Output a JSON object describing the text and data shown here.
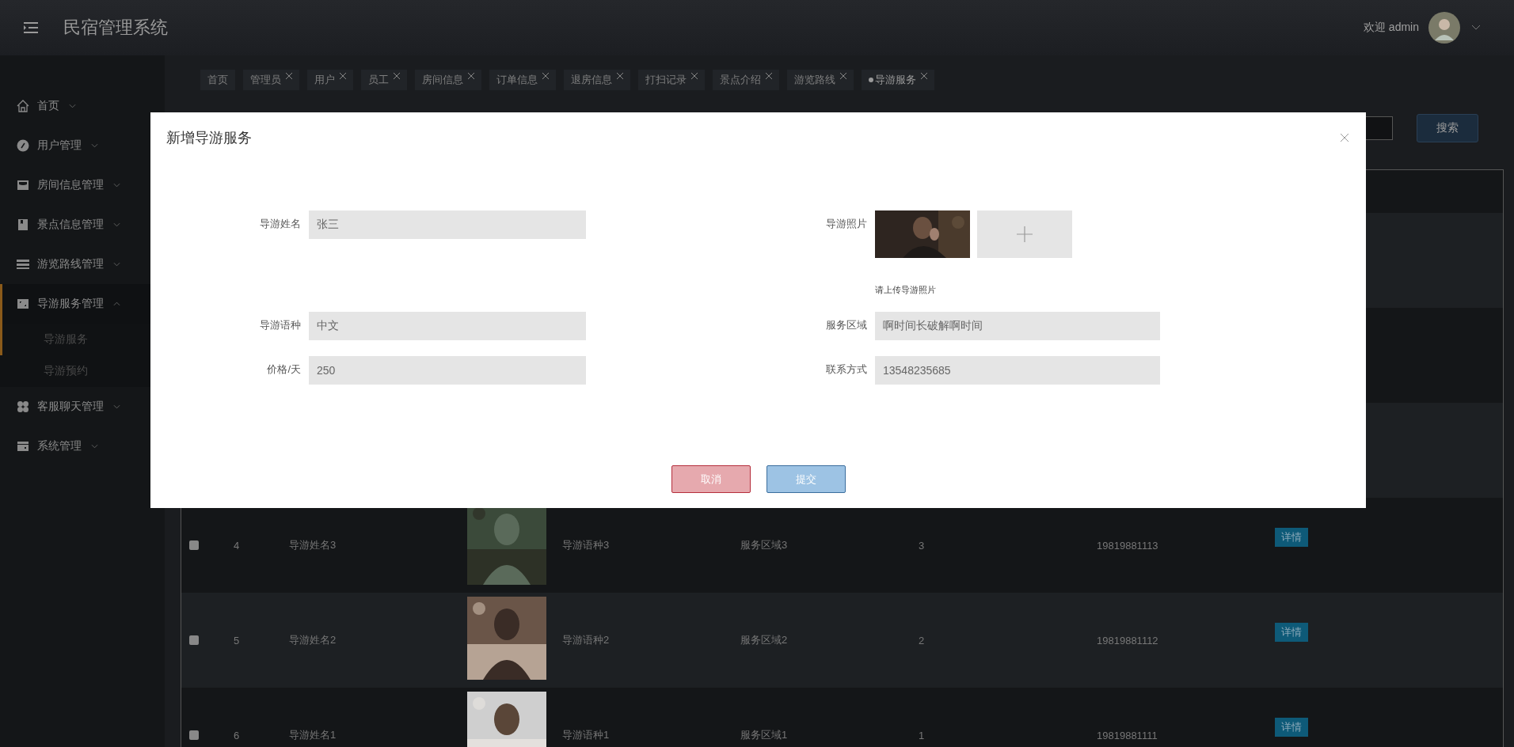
{
  "header": {
    "title": "民宿管理系统",
    "welcome": "欢迎 admin"
  },
  "sidebar": {
    "items": [
      {
        "label": "首页",
        "expanded": false,
        "selected": false
      },
      {
        "label": "用户管理",
        "expanded": false,
        "selected": false
      },
      {
        "label": "房间信息管理",
        "expanded": false,
        "selected": false
      },
      {
        "label": "景点信息管理",
        "expanded": false,
        "selected": false
      },
      {
        "label": "游览路线管理",
        "expanded": false,
        "selected": false
      },
      {
        "label": "导游服务管理",
        "expanded": true,
        "selected": true,
        "children": [
          {
            "label": "导游服务",
            "selected": true
          },
          {
            "label": "导游预约",
            "selected": false
          }
        ]
      },
      {
        "label": "客服聊天管理",
        "expanded": false,
        "selected": false
      },
      {
        "label": "系统管理",
        "expanded": false,
        "selected": false
      }
    ]
  },
  "tabs": [
    {
      "label": "首页",
      "closable": false,
      "selected": false
    },
    {
      "label": "管理员",
      "closable": true,
      "selected": false
    },
    {
      "label": "用户",
      "closable": true,
      "selected": false
    },
    {
      "label": "员工",
      "closable": true,
      "selected": false
    },
    {
      "label": "房间信息",
      "closable": true,
      "selected": false
    },
    {
      "label": "订单信息",
      "closable": true,
      "selected": false
    },
    {
      "label": "退房信息",
      "closable": true,
      "selected": false
    },
    {
      "label": "打扫记录",
      "closable": true,
      "selected": false
    },
    {
      "label": "景点介绍",
      "closable": true,
      "selected": false
    },
    {
      "label": "游览路线",
      "closable": true,
      "selected": false
    },
    {
      "label": "导游服务",
      "closable": true,
      "selected": true
    }
  ],
  "search": {
    "button": "搜索"
  },
  "table": {
    "rows": [
      {
        "checked": false,
        "index": "4",
        "name": "导游姓名3",
        "language": "导游语种3",
        "area": "服务区域3",
        "price": "3",
        "phone": "19819881113",
        "action": "详情"
      },
      {
        "checked": false,
        "index": "5",
        "name": "导游姓名2",
        "language": "导游语种2",
        "area": "服务区域2",
        "price": "2",
        "phone": "19819881112",
        "action": "详情"
      },
      {
        "checked": false,
        "index": "6",
        "name": "导游姓名1",
        "language": "导游语种1",
        "area": "服务区域1",
        "price": "1",
        "phone": "19819881111",
        "action": "详情"
      }
    ]
  },
  "dialog": {
    "title": "新增导游服务",
    "fields": [
      {
        "kind": "text",
        "label": "导游姓名",
        "value": "张三"
      },
      {
        "label": "导游照片",
        "hint": "请上传导游照片"
      },
      {
        "kind": "text",
        "label": "导游语种",
        "value": "中文"
      },
      {
        "kind": "text",
        "label": "服务区域",
        "value": "啊时间长破解啊时间"
      },
      {
        "kind": "text",
        "label": "价格/天",
        "value": "250"
      },
      {
        "kind": "text",
        "label": "联系方式",
        "value": "13548235685"
      }
    ],
    "buttons": [
      {
        "kind": "cancel",
        "label": "取消"
      },
      {
        "kind": "submit",
        "label": "提交"
      }
    ]
  }
}
